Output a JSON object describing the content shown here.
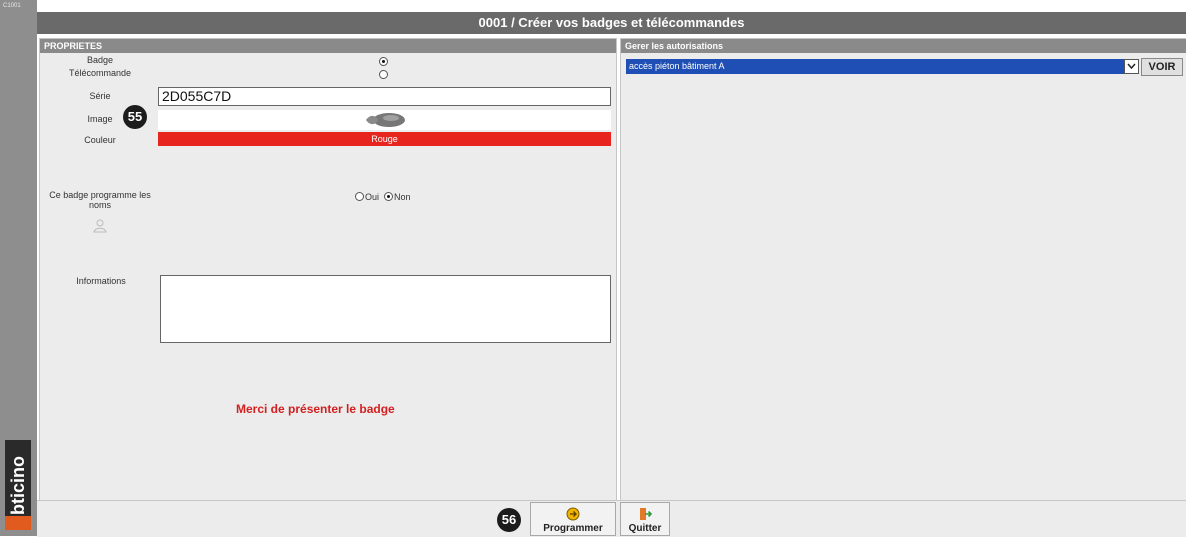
{
  "app": {
    "code": "C1001",
    "brand": "bticino"
  },
  "window": {
    "title": "0001 / Créer vos badges et télécommandes"
  },
  "left_panel": {
    "header": "PROPRIETES",
    "type_options": [
      {
        "label": "Badge",
        "selected": true
      },
      {
        "label": "Télécommande",
        "selected": false
      }
    ],
    "serie_label": "Série",
    "serie_value": "2D055C7D",
    "image_label": "Image",
    "couleur_label": "Couleur",
    "couleur_value": "Rouge",
    "couleur_hex": "#e8241f",
    "program_names_label": "Ce badge programme les noms",
    "oui_label": "Oui",
    "non_label": "Non",
    "program_names_selected": "Non",
    "informations_label": "Informations",
    "informations_value": "",
    "message": "Merci de présenter le badge"
  },
  "right_panel": {
    "header": "Gerer les autorisations",
    "selected_authorisation": "accès piéton bâtiment A",
    "voir_label": "VOIR"
  },
  "footer": {
    "programmer_label": "Programmer",
    "quitter_label": "Quitter"
  },
  "callouts": {
    "image_marker": "55",
    "programmer_marker": "56"
  }
}
